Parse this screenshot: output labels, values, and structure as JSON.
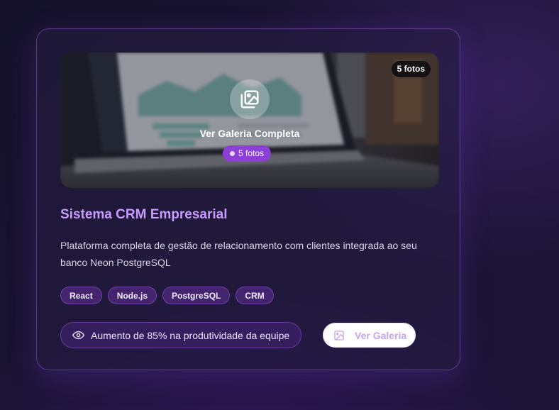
{
  "card": {
    "media": {
      "photo_count_badge": "5 fotos",
      "overlay_title": "Ver Galeria Completa",
      "overlay_pill": "5 fotos",
      "icon": "gallery-icon"
    },
    "title": "Sistema CRM Empresarial",
    "description": "Plataforma completa de gestão de relacionamento com clientes integrada ao seu banco Neon PostgreSQL",
    "tags": [
      "React",
      "Node.js",
      "PostgreSQL",
      "CRM"
    ],
    "metric": {
      "icon": "eye-icon",
      "text": "Aumento de 85% na produtividade da equipe"
    },
    "gallery_button": {
      "icon": "image-icon",
      "label": "Ver Galeria"
    }
  },
  "colors": {
    "accent": "#8b3fd6",
    "title": "#c89bff",
    "background": "#1a1433"
  }
}
